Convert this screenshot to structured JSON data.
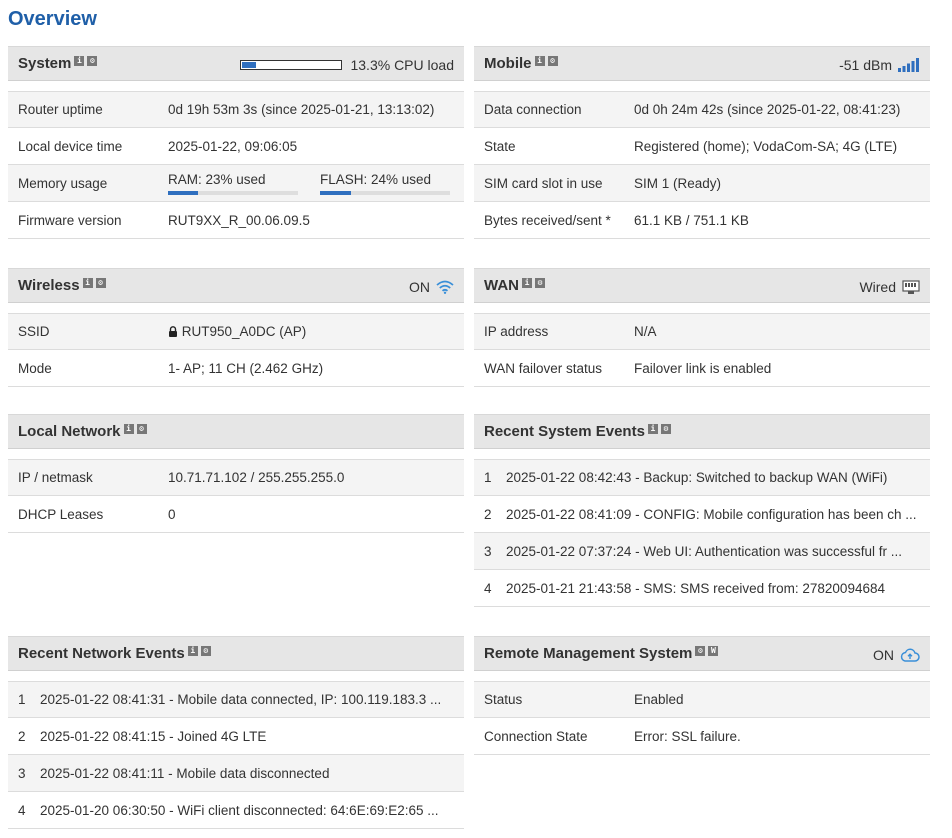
{
  "title": "Overview",
  "system": {
    "title": "System",
    "cpu_text": "13.3% CPU load",
    "cpu_load": 0.133,
    "rows": [
      {
        "label": "Router uptime",
        "value": "0d 19h 53m 3s (since 2025-01-21, 13:13:02)"
      },
      {
        "label": "Local device time",
        "value": "2025-01-22, 09:06:05"
      },
      {
        "label": "Memory usage",
        "ram_text": "RAM: 23% used",
        "ram": 0.23,
        "flash_text": "FLASH: 24% used",
        "flash": 0.24
      },
      {
        "label": "Firmware version",
        "value": "RUT9XX_R_00.06.09.5"
      }
    ]
  },
  "mobile": {
    "title": "Mobile",
    "signal": "-51 dBm",
    "rows": [
      {
        "label": "Data connection",
        "value": "0d 0h 24m 42s (since 2025-01-22, 08:41:23)"
      },
      {
        "label": "State",
        "value": "Registered (home); VodaCom-SA; 4G (LTE)"
      },
      {
        "label": "SIM card slot in use",
        "value": "SIM 1 (Ready)"
      },
      {
        "label": "Bytes received/sent *",
        "value": "61.1 KB / 751.1 KB"
      }
    ]
  },
  "wireless": {
    "title": "Wireless",
    "status": "ON",
    "rows": [
      {
        "label": "SSID",
        "value": "RUT950_A0DC (AP)"
      },
      {
        "label": "Mode",
        "value": "1- AP; 11 CH (2.462 GHz)"
      }
    ]
  },
  "wan": {
    "title": "WAN",
    "status": "Wired",
    "rows": [
      {
        "label": "IP address",
        "value": "N/A"
      },
      {
        "label": "WAN failover status",
        "value": "Failover link is enabled"
      }
    ]
  },
  "local_network": {
    "title": "Local Network",
    "rows": [
      {
        "label": "IP / netmask",
        "value": "10.71.71.102 / 255.255.255.0"
      },
      {
        "label": "DHCP Leases",
        "value": "0"
      }
    ]
  },
  "recent_system_events": {
    "title": "Recent System Events",
    "events": [
      {
        "n": "1",
        "text": "2025-01-22 08:42:43 - Backup: Switched to backup WAN (WiFi)"
      },
      {
        "n": "2",
        "text": "2025-01-22 08:41:09 - CONFIG: Mobile configuration has been ch ..."
      },
      {
        "n": "3",
        "text": "2025-01-22 07:37:24 - Web UI: Authentication was successful fr ..."
      },
      {
        "n": "4",
        "text": "2025-01-21 21:43:58 - SMS: SMS received from: 27820094684"
      }
    ]
  },
  "recent_network_events": {
    "title": "Recent Network Events",
    "events": [
      {
        "n": "1",
        "text": "2025-01-22 08:41:31 - Mobile data connected, IP: 100.119.183.3 ..."
      },
      {
        "n": "2",
        "text": "2025-01-22 08:41:15 - Joined 4G LTE"
      },
      {
        "n": "3",
        "text": "2025-01-22 08:41:11 - Mobile data disconnected"
      },
      {
        "n": "4",
        "text": "2025-01-20 06:30:50 - WiFi client disconnected: 64:6E:69:E2:65 ..."
      }
    ]
  },
  "rms": {
    "title": "Remote Management System",
    "status": "ON",
    "rows": [
      {
        "label": "Status",
        "value": "Enabled"
      },
      {
        "label": "Connection State",
        "value": "Error: SSL failure."
      }
    ]
  },
  "icons": {
    "info": "info-icon",
    "settings": "settings-icon",
    "window": "window-icon"
  },
  "colors": {
    "accent": "#1f5fa8",
    "bar": "#2f6fbf",
    "header_bg": "#e6e6e6"
  }
}
